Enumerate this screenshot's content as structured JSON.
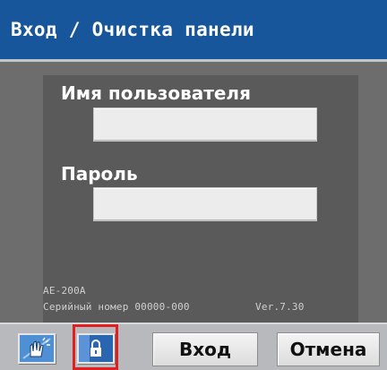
{
  "title": "Вход / Очистка панели",
  "form": {
    "username_label": "Имя пользователя",
    "username_value": "",
    "password_label": "Пароль",
    "password_value": ""
  },
  "device_info": {
    "model": "AE-200A",
    "serial": "Серийный номер 00000-000",
    "version": "Ver.7.30"
  },
  "toolbar": {
    "panel_clean_icon": "hand-wipe-icon",
    "lock_icon": "lock-icon",
    "login_label": "Вход",
    "cancel_label": "Отмена"
  },
  "colors": {
    "title_bar": "#17569a",
    "background": "#6d6d6d",
    "panel": "#5a5a5a",
    "highlight": "#e02020"
  }
}
